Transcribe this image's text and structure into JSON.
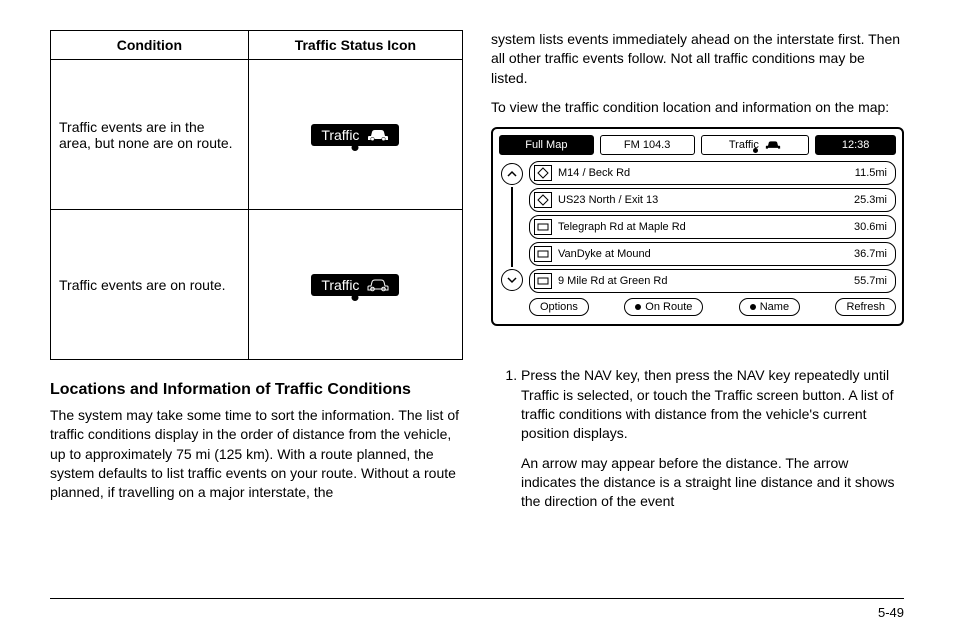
{
  "table": {
    "header_condition": "Condition",
    "header_icon": "Traffic Status Icon",
    "row1_text": "Traffic events are in the area, but none are on route.",
    "row2_text": "Traffic events are on route.",
    "badge_label": "Traffic"
  },
  "left": {
    "heading": "Locations and Information of Traffic Conditions",
    "para": "The system may take some time to sort the information. The list of traffic conditions display in the order of distance from the vehicle, up to approximately 75 mi (125 km). With a route planned, the system defaults to list traffic events on your route. Without a route planned, if travelling on a major interstate, the"
  },
  "right": {
    "para1": "system lists events immediately ahead on the interstate first. Then all other traffic events follow. Not all traffic conditions may be listed.",
    "para2": "To view the traffic condition location and information on the map:",
    "step1a": "Press the NAV key, then press the NAV key repeatedly until Traffic is selected, or touch the Traffic screen button. A list of traffic conditions with distance from the vehicle's current position displays.",
    "step1b": "An arrow may appear before the distance. The arrow indicates the distance is a straight line distance and it shows the direction of the event"
  },
  "nav": {
    "fullmap": "Full Map",
    "radio": "FM 104.3",
    "traffic": "Traffic",
    "clock": "12:38",
    "rows": [
      {
        "name": "M14 / Beck Rd",
        "dist": "11.5mi"
      },
      {
        "name": "US23 North / Exit 13",
        "dist": "25.3mi"
      },
      {
        "name": "Telegraph Rd at Maple Rd",
        "dist": "30.6mi"
      },
      {
        "name": "VanDyke at Mound",
        "dist": "36.7mi"
      },
      {
        "name": "9 Mile Rd at Green Rd",
        "dist": "55.7mi"
      }
    ],
    "options": "Options",
    "onroute": "On Route",
    "byname": "Name",
    "refresh": "Refresh"
  },
  "page_number": "5-49"
}
